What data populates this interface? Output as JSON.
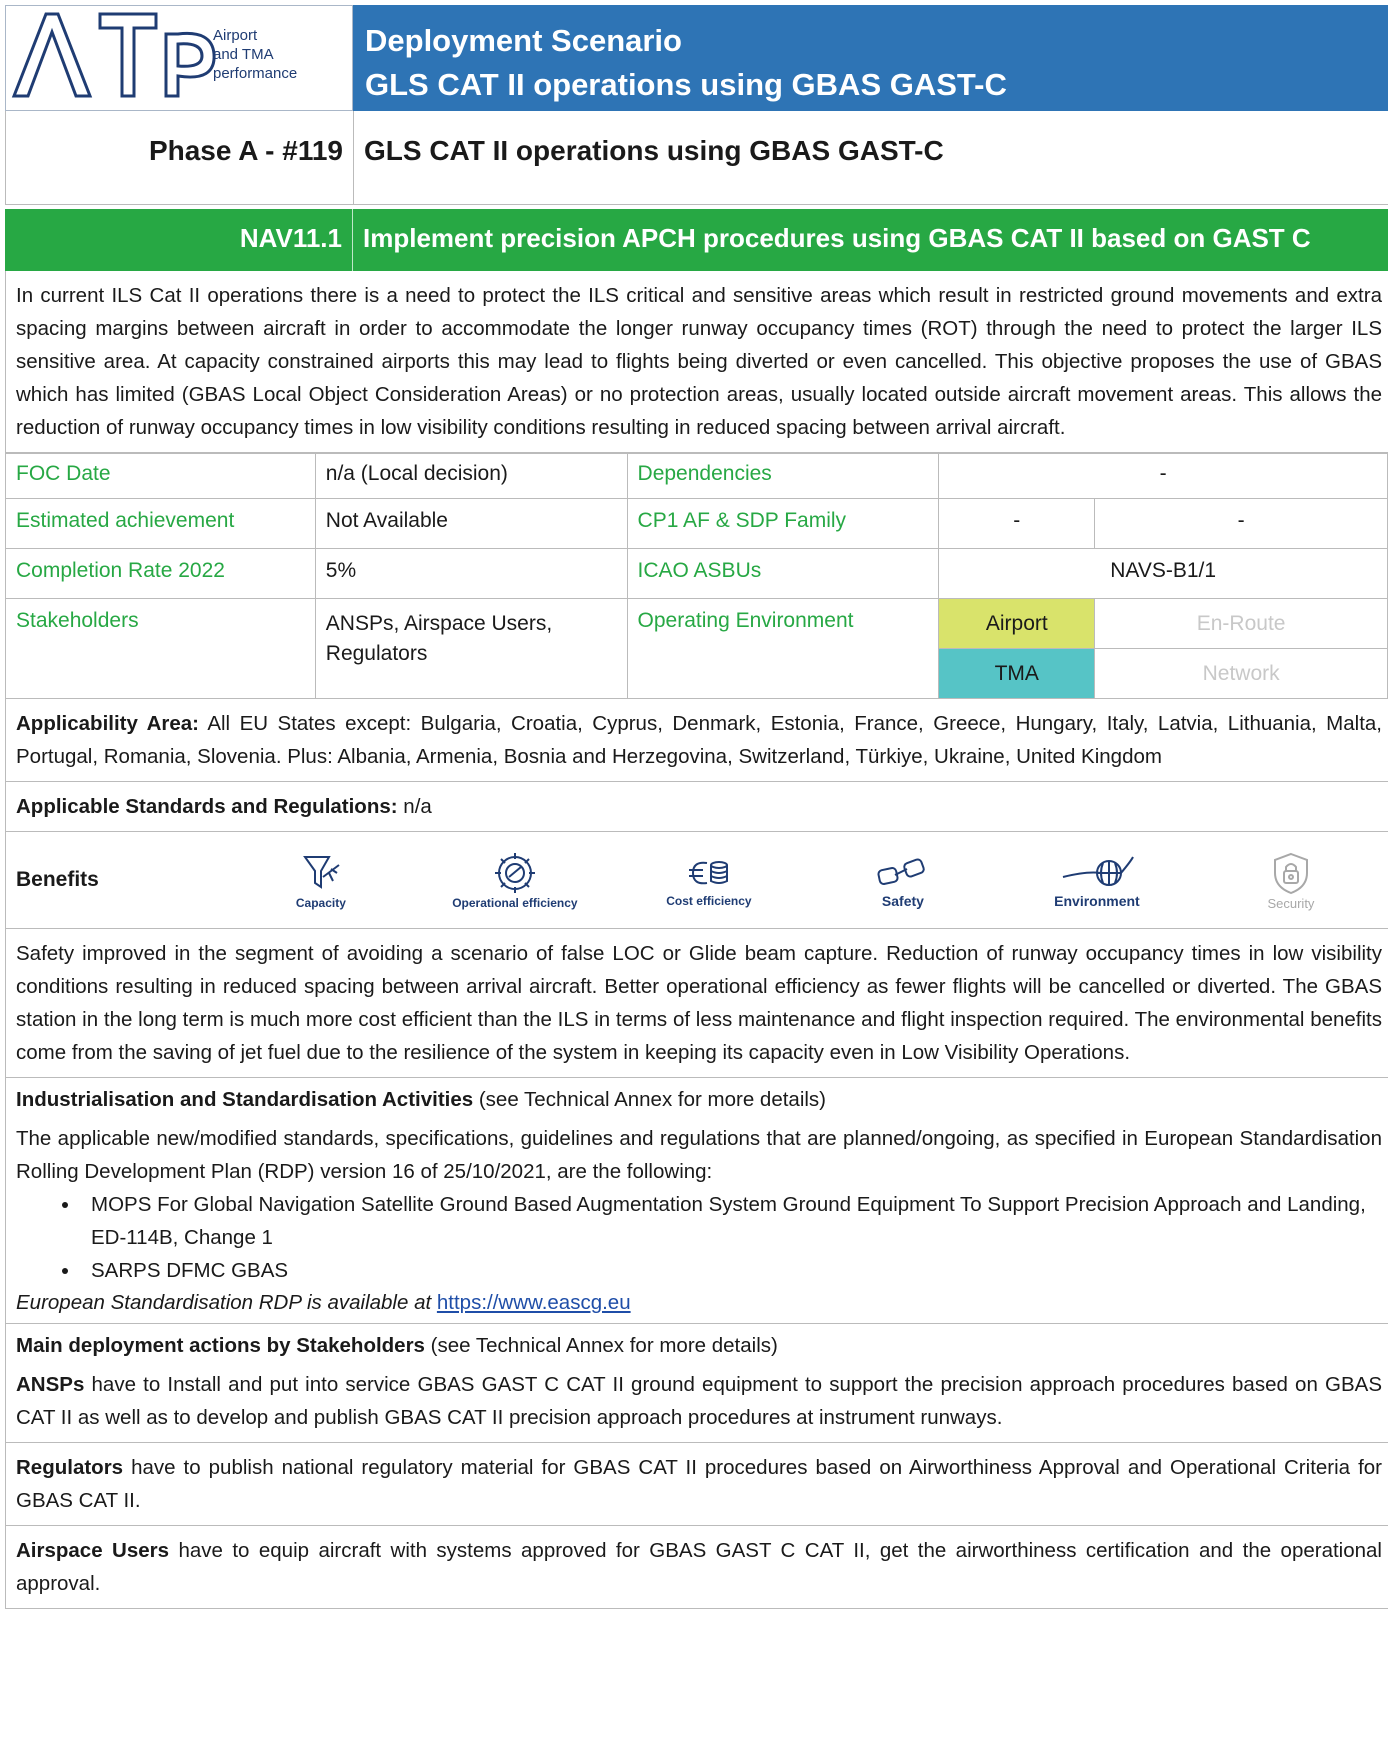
{
  "logo": {
    "letters": "ATp",
    "line1": "Airport",
    "line2": "and TMA",
    "line3": "performance"
  },
  "header": {
    "title_line1": "Deployment Scenario",
    "title_line2": "GLS CAT II operations using GBAS GAST-C"
  },
  "phase": {
    "code": "Phase A - #119",
    "name": "GLS CAT II operations using GBAS GAST-C"
  },
  "objective": {
    "code": "NAV11.1",
    "name": "Implement precision APCH procedures using GBAS CAT II based on GAST C"
  },
  "description": "In current ILS Cat II operations there is a need to protect the ILS critical and sensitive areas which result in restricted ground movements and extra spacing margins between aircraft in order to accommodate the longer runway occupancy times (ROT) through the need to protect the larger ILS sensitive area. At capacity constrained airports this may lead to flights being diverted or even cancelled. This objective proposes the use of GBAS which has limited (GBAS Local Object Consideration Areas) or no protection areas, usually located outside aircraft movement areas. This allows the reduction of runway occupancy times in low visibility conditions resulting in reduced spacing between arrival aircraft.",
  "info": {
    "foc_label": "FOC Date",
    "foc_value": "n/a (Local decision)",
    "dependencies_label": "Dependencies",
    "dependencies_value": "-",
    "estimated_label": "Estimated achievement",
    "estimated_value": "Not Available",
    "cp1_label": "CP1 AF & SDP Family",
    "cp1_value1": "-",
    "cp1_value2": "-",
    "completion_label": "Completion Rate 2022",
    "completion_value": "5%",
    "icao_label": "ICAO ASBUs",
    "icao_value": "NAVS-B1/1",
    "stakeholders_label": "Stakeholders",
    "stakeholders_value": "ANSPs, Airspace Users, Regulators",
    "env_label": "Operating Environment",
    "env_airport": "Airport",
    "env_enroute": "En-Route",
    "env_tma": "TMA",
    "env_network": "Network",
    "env_airport_color": "#d9e36b",
    "env_tma_color": "#56c4c6"
  },
  "applicability": {
    "label": "Applicability Area:",
    "text": " All EU States except: Bulgaria, Croatia, Cyprus, Denmark, Estonia, France, Greece, Hungary, Italy, Latvia, Lithuania, Malta, Portugal, Romania, Slovenia. Plus: Albania, Armenia, Bosnia and Herzegovina, Switzerland, Türkiye, Ukraine, United Kingdom"
  },
  "standards": {
    "label": "Applicable Standards and Regulations:",
    "text": " n/a"
  },
  "benefits": {
    "label": "Benefits",
    "items": [
      {
        "name": "Capacity",
        "icon": "capacity-icon"
      },
      {
        "name": "Operational efficiency",
        "icon": "operational-efficiency-icon"
      },
      {
        "name": "Cost efficiency",
        "icon": "cost-efficiency-icon"
      },
      {
        "name": "Safety",
        "icon": "safety-icon"
      },
      {
        "name": "Environment",
        "icon": "environment-icon"
      },
      {
        "name": "Security",
        "icon": "security-icon"
      }
    ],
    "text": "Safety improved in the segment of avoiding a scenario of false LOC or Glide beam capture. Reduction of runway occupancy times in low visibility conditions resulting in reduced spacing between arrival aircraft. Better operational efficiency as fewer flights will be cancelled or diverted. The GBAS station in the long term is much more cost efficient than the ILS in terms of less maintenance and flight inspection required. The environmental benefits come from the saving of jet fuel due to the resilience of the system in keeping its capacity even in Low Visibility Operations."
  },
  "industrialisation": {
    "title": "Industrialisation and Standardisation Activities",
    "note": " (see Technical Annex for more details)",
    "intro": "The applicable new/modified standards, specifications, guidelines and regulations that are planned/ongoing, as specified in European Standardisation Rolling Development Plan (RDP) version 16 of 25/10/2021, are the following:",
    "items": [
      "MOPS For Global Navigation Satellite Ground Based Augmentation System Ground Equipment To Support Precision Approach and Landing, ED-114B, Change 1",
      "SARPS DFMC GBAS"
    ],
    "rdp_text": "European Standardisation RDP is available at ",
    "rdp_link": "https://www.eascg.eu"
  },
  "deployment": {
    "title": "Main deployment actions by Stakeholders",
    "note": " (see Technical Annex for more details)",
    "actions": [
      {
        "who": "ANSPs",
        "text": " have to Install and put into service GBAS GAST C CAT II ground equipment to support the precision approach procedures based on GBAS CAT II as well as to develop and publish GBAS CAT II precision approach procedures at instrument runways."
      },
      {
        "who": "Regulators",
        "text": " have to publish national regulatory material for GBAS CAT II procedures based on Airworthiness Approval and Operational Criteria for GBAS CAT II."
      },
      {
        "who": "Airspace Users",
        "text": " have to equip aircraft with systems approved for GBAS GAST C CAT II, get the airworthiness certification and the operational approval."
      }
    ]
  }
}
